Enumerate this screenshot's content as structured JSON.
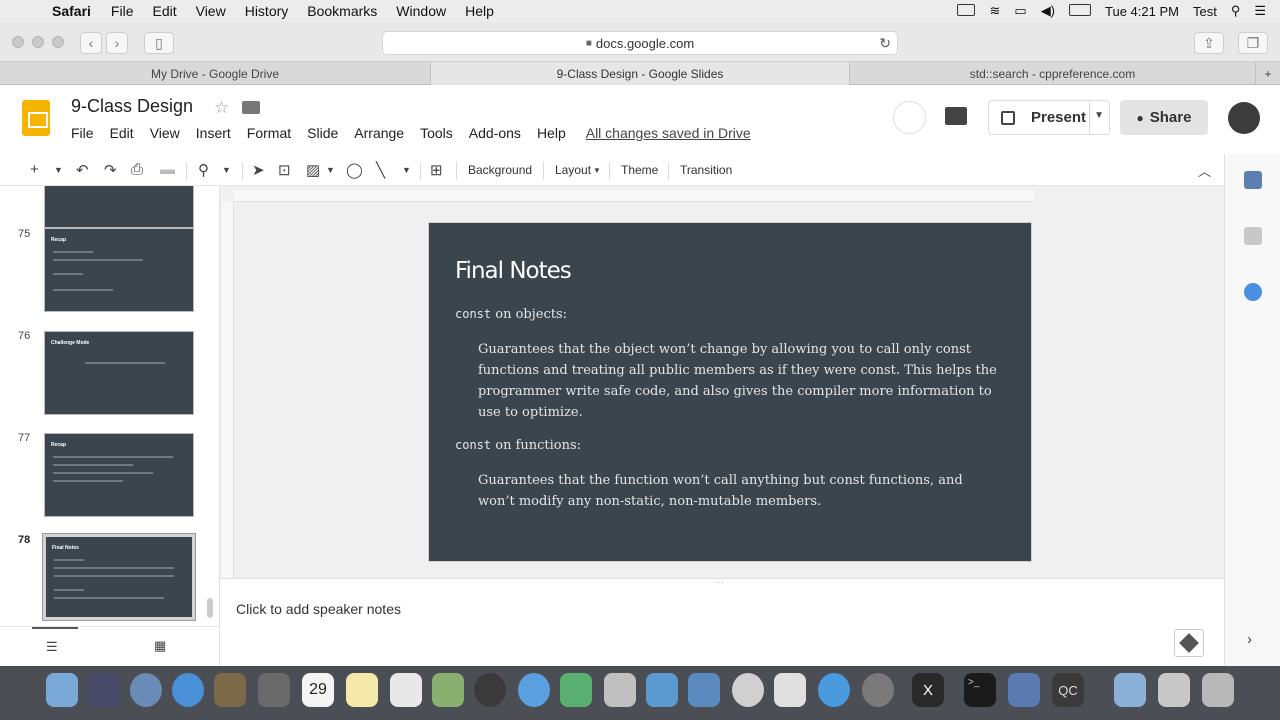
{
  "menubar": {
    "app": "Safari",
    "items": [
      "File",
      "Edit",
      "View",
      "History",
      "Bookmarks",
      "Window",
      "Help"
    ],
    "clock": "Tue 4:21 PM",
    "user": "Test"
  },
  "browser": {
    "url": "docs.google.com",
    "tabs": [
      {
        "label": "My Drive - Google Drive",
        "active": false
      },
      {
        "label": "9-Class Design - Google Slides",
        "active": true
      },
      {
        "label": "std::search - cppreference.com",
        "active": false
      }
    ]
  },
  "doc": {
    "title": "9-Class Design",
    "menus": [
      "File",
      "Edit",
      "View",
      "Insert",
      "Format",
      "Slide",
      "Arrange",
      "Tools",
      "Add-ons",
      "Help"
    ],
    "saved_status": "All changes saved in Drive",
    "present_label": "Present",
    "share_label": "Share"
  },
  "toolbar": {
    "background_label": "Background",
    "layout_label": "Layout",
    "theme_label": "Theme",
    "transition_label": "Transition"
  },
  "filmstrip": {
    "slides": [
      {
        "number": "75",
        "title": "Recap",
        "selected": false
      },
      {
        "number": "76",
        "title": "Challenge Mode",
        "selected": false
      },
      {
        "number": "77",
        "title": "Recap",
        "selected": false
      },
      {
        "number": "78",
        "title": "Final Notes",
        "selected": true
      }
    ]
  },
  "slide": {
    "title": "Final Notes",
    "section1_code": "const",
    "section1_rest": " on objects:",
    "section1_body": "Guarantees that the object won’t change by allowing you to call only const functions and treating all public members as if they were const. This helps the programmer write safe code, and also gives the compiler more information to use to optimize.",
    "section2_code": "const",
    "section2_rest": " on functions:",
    "section2_body": "Guarantees that the function won’t call anything but const functions, and won’t modify any non-static, non-mutable members."
  },
  "notes": {
    "placeholder": "Click to add speaker notes"
  },
  "dock": {
    "calendar_day": "29",
    "qc_label": "QC"
  }
}
